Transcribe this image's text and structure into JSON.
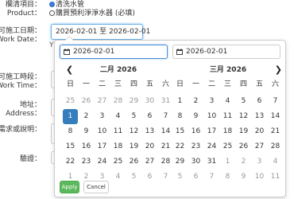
{
  "form": {
    "project_label": "欄清項目：",
    "project_radio1": "清洗水管",
    "product_label": "Product：",
    "product_radio2": "購買預利淨淨水器 (必填)",
    "workdate_label_zh": "可施工日期：",
    "workdate_label_en": "Work Date：",
    "workdate_value": "2026-02-01 至 2026-02-01",
    "worktime_label_zh": "可施工時段：",
    "worktime_label_en": "Work Time：",
    "address_label_zh": "地址：",
    "address_label_en": "Address：",
    "other_label": "他需求或說明：",
    "captcha_label": "驗證："
  },
  "picker": {
    "start_value": "2026-02-01",
    "end_value": "2026-02-01",
    "weekdays": [
      "日",
      "一",
      "二",
      "三",
      "四",
      "五",
      "六"
    ],
    "left_month": {
      "title": "二月 2026",
      "weeks": [
        [
          "25",
          "26",
          "27",
          "28",
          "29",
          "30",
          "31"
        ],
        [
          "1",
          "2",
          "3",
          "4",
          "5",
          "6",
          "7"
        ],
        [
          "8",
          "9",
          "10",
          "11",
          "12",
          "13",
          "14"
        ],
        [
          "15",
          "16",
          "17",
          "18",
          "19",
          "20",
          "21"
        ],
        [
          "22",
          "23",
          "24",
          "25",
          "26",
          "27",
          "28"
        ],
        [
          "1",
          "2",
          "3",
          "4",
          "5",
          "6",
          "7"
        ]
      ]
    },
    "right_month": {
      "title": "三月 2026",
      "weeks": [
        [
          "1",
          "2",
          "3",
          "4",
          "5",
          "6",
          "7"
        ],
        [
          "8",
          "9",
          "10",
          "11",
          "12",
          "13",
          "14"
        ],
        [
          "15",
          "16",
          "17",
          "18",
          "19",
          "20",
          "21"
        ],
        [
          "22",
          "23",
          "24",
          "25",
          "26",
          "27",
          "28"
        ],
        [
          "29",
          "30",
          "31",
          "1",
          "2",
          "3",
          "4"
        ],
        [
          "5",
          "6",
          "7",
          "8",
          "9",
          "10",
          "11"
        ]
      ]
    },
    "apply_label": "Apply",
    "cancel_label": "Cancel",
    "selected_color": "#357ebd",
    "apply_color": "#5cb85c"
  }
}
